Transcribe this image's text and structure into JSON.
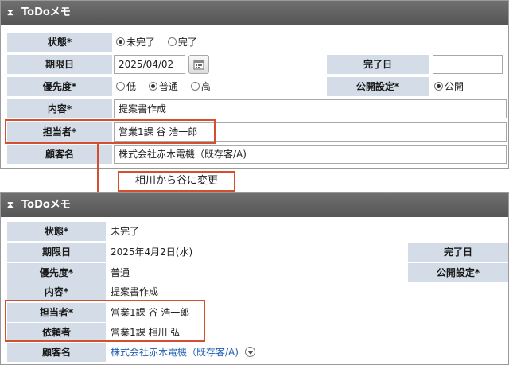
{
  "panel1": {
    "title": "ToDoメモ",
    "status": {
      "label": "状態*",
      "options": [
        "未完了",
        "完了"
      ],
      "selected": "未完了"
    },
    "due": {
      "label": "期限日",
      "value": "2025/04/02"
    },
    "completed": {
      "label": "完了日",
      "value": ""
    },
    "priority": {
      "label": "優先度*",
      "options": [
        "低",
        "普通",
        "高"
      ],
      "selected": "普通"
    },
    "visibility": {
      "label": "公開設定*",
      "options": [
        "公開",
        ""
      ],
      "selected": "公開"
    },
    "content": {
      "label": "内容*",
      "value": "提案書作成"
    },
    "assignee": {
      "label": "担当者*",
      "value": "営業1課 谷 浩一郎"
    },
    "customer": {
      "label": "顧客名",
      "value": "株式会社赤木電機（既存客/A)"
    }
  },
  "callout": "相川から谷に変更",
  "panel2": {
    "title": "ToDoメモ",
    "status": {
      "label": "状態*",
      "value": "未完了"
    },
    "due": {
      "label": "期限日",
      "value": "2025年4月2日(水)"
    },
    "completed": {
      "label": "完了日",
      "value": ""
    },
    "priority": {
      "label": "優先度*",
      "value": "普通"
    },
    "visibility": {
      "label": "公開設定*",
      "value": ""
    },
    "content": {
      "label": "内容*",
      "value": "提案書作成"
    },
    "assignee": {
      "label": "担当者*",
      "value": "営業1課 谷 浩一郎"
    },
    "requester": {
      "label": "依頼者",
      "value": "営業1課 相川 弘"
    },
    "customer": {
      "label": "顧客名",
      "value": "株式会社赤木電機（既存客/A)"
    }
  },
  "colors": {
    "highlight": "#d2502f",
    "label_bg": "#d4dde7",
    "title_bg": "#5f5f5f",
    "link": "#1f5fb0"
  },
  "icons": [
    "collapse-icon",
    "calendar-icon",
    "dropdown-icon"
  ]
}
